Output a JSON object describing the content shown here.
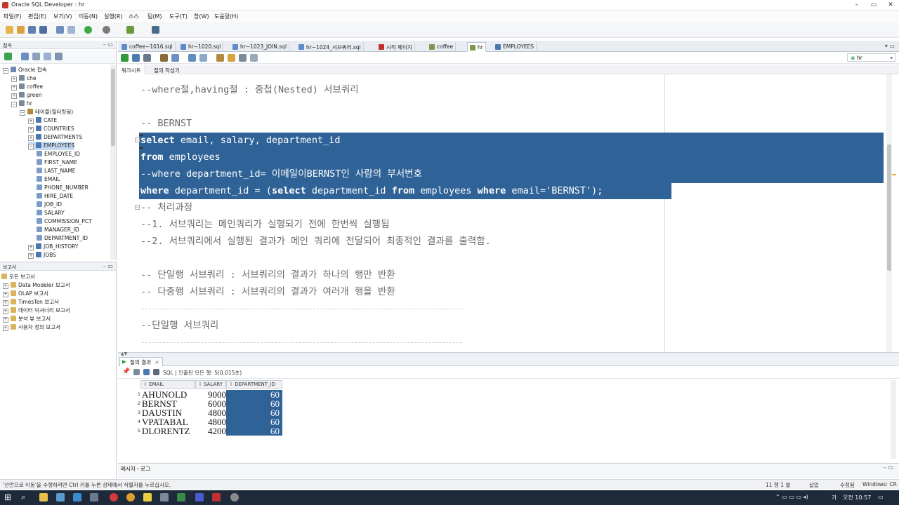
{
  "window": {
    "title": "Oracle SQL Developer : hr"
  },
  "menu": [
    "파일(F)",
    "편집(E)",
    "보기(V)",
    "이동(N)",
    "실행(R)",
    "소스",
    "팀(M)",
    "도구(T)",
    "창(W)",
    "도움말(H)"
  ],
  "connections_panel": {
    "title": "접속",
    "tree": [
      {
        "label": "Oracle 접속",
        "level": 0
      },
      {
        "label": "che",
        "level": 1
      },
      {
        "label": "coffee",
        "level": 1
      },
      {
        "label": "green",
        "level": 1
      },
      {
        "label": "hr",
        "level": 1
      },
      {
        "label": "테이블(필터링됨)",
        "level": 2
      },
      {
        "label": "CATE",
        "level": 3
      },
      {
        "label": "COUNTRIES",
        "level": 3
      },
      {
        "label": "DEPARTMENTS",
        "level": 3
      },
      {
        "label": "EMPLOYEES",
        "level": 3
      },
      {
        "label": "EMPLOYEE_ID",
        "level": 4
      },
      {
        "label": "FIRST_NAME",
        "level": 4
      },
      {
        "label": "LAST_NAME",
        "level": 4
      },
      {
        "label": "EMAIL",
        "level": 4
      },
      {
        "label": "PHONE_NUMBER",
        "level": 4
      },
      {
        "label": "HIRE_DATE",
        "level": 4
      },
      {
        "label": "JOB_ID",
        "level": 4
      },
      {
        "label": "SALARY",
        "level": 4
      },
      {
        "label": "COMMISSION_PCT",
        "level": 4
      },
      {
        "label": "MANAGER_ID",
        "level": 4
      },
      {
        "label": "DEPARTMENT_ID",
        "level": 4
      },
      {
        "label": "JOB_HISTORY",
        "level": 3
      },
      {
        "label": "JOBS",
        "level": 3
      }
    ]
  },
  "reports_panel": {
    "title": "보고서",
    "items": [
      "모든 보고서",
      "Data Modeler 보고서",
      "OLAP 보고서",
      "TimesTen 보고서",
      "데이터 딕셔너리 보고서",
      "분석 뷰 보고서",
      "사용자 정의 보고서"
    ]
  },
  "editor_tabs": [
    "coffee~1016.sql",
    "hr~1020.sql",
    "hr~1023_JOIN.sql",
    "hr~1024_서브쿼리.sql",
    "시작 페이지",
    "coffee",
    "hr",
    "EMPLOYEES"
  ],
  "active_tab": "hr",
  "connection_selector": "hr",
  "subtabs": [
    "워크시트",
    "질의 작성기"
  ],
  "code_lines": [
    {
      "text": "--where절,having절 : 중첩(Nested) 서브쿼리",
      "selected": false
    },
    {
      "text": "",
      "selected": false
    },
    {
      "text": "-- BERNST",
      "selected": false
    },
    {
      "text": "select email, salary, department_id",
      "selected": true
    },
    {
      "text": "from employees",
      "selected": true
    },
    {
      "text": "--where department_id= 이메일이BERNST인 사람의 부서번호",
      "selected": true
    },
    {
      "text": "where department_id = (select department_id from employees where email='BERNST');",
      "selected": true
    },
    {
      "text": "-- 처리과정",
      "selected": false
    },
    {
      "text": "--1. 서브쿼리는 메인쿼리가 실행되기 전에 한번씩 실행됨",
      "selected": false
    },
    {
      "text": "--2. 서브쿼리에서 실행된 결과가 메인 쿼리에 전달되어 최종적인 결과를 출력함.",
      "selected": false
    },
    {
      "text": "",
      "selected": false
    },
    {
      "text": "-- 단일행 서브쿼리 : 서브쿼리의 결과가 하나의 행만 반환",
      "selected": false
    },
    {
      "text": "-- 다중행 서브쿼리 : 서브쿼리의 결과가 여러개 행을 반환",
      "selected": false
    },
    {
      "text": "---------------------------------------------------",
      "selected": false
    },
    {
      "text": "--단일행 서브쿼리",
      "selected": false
    },
    {
      "text": "---------------------------------------------------",
      "selected": false
    }
  ],
  "results": {
    "tab_label": "질의 결과",
    "toolbar_text": "SQL | 인출된 모든 행: 5(0.015초)",
    "columns": [
      "EMAIL",
      "SALARY",
      "DEPARTMENT_ID"
    ],
    "rows": [
      [
        "AHUNOLD",
        "9000",
        "60"
      ],
      [
        "BERNST",
        "6000",
        "60"
      ],
      [
        "DAUSTIN",
        "4800",
        "60"
      ],
      [
        "VPATABAL",
        "4800",
        "60"
      ],
      [
        "DLORENTZ",
        "4200",
        "60"
      ]
    ]
  },
  "message_tab": "메시지 - 로그",
  "status": {
    "left": "'선언으로 이동'을 수행하려면 Ctrl 키를 누른 상태에서 식별자를 누르십시오.",
    "position": "11 행 1 열",
    "insert": "삽입",
    "modified": "수정됨",
    "os": "Windows: CR"
  },
  "taskbar": {
    "ime": "가",
    "time": "오전 10:57"
  },
  "colors": {
    "selection": "#2f6297",
    "taskbar": "#1e2a3a"
  }
}
